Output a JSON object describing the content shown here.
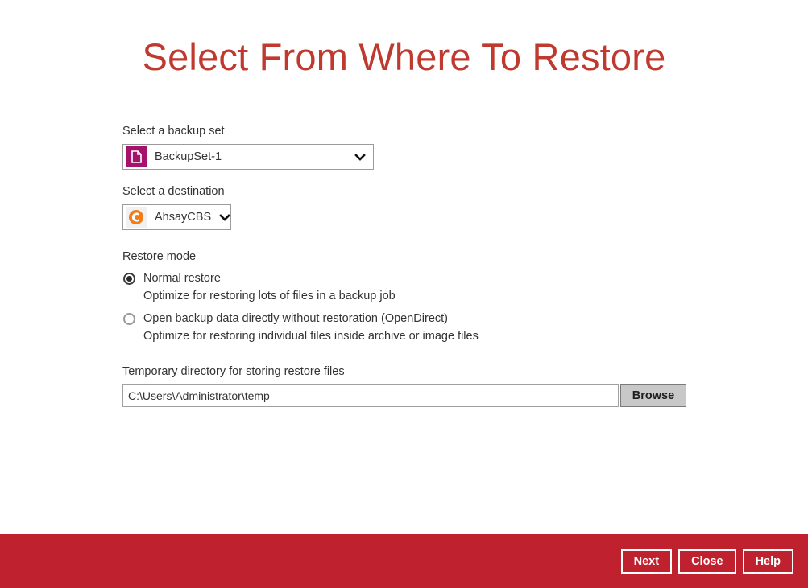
{
  "page": {
    "title": "Select From Where To Restore",
    "accent_color": "#c0392f",
    "footer_color": "#c0212f"
  },
  "backup_set": {
    "label": "Select a backup set",
    "selected": "BackupSet-1",
    "icon": "document-icon",
    "icon_color": "#a4126b",
    "caret": "chevron-down-icon"
  },
  "destination": {
    "label": "Select a destination",
    "selected": "AhsayCBS",
    "icon": "cbs-circle-icon",
    "icon_color": "#f07d1a",
    "caret": "chevron-down-icon"
  },
  "restore_mode": {
    "label": "Restore mode",
    "options": [
      {
        "label": "Normal restore",
        "description": "Optimize for restoring lots of files in a backup job",
        "selected": true
      },
      {
        "label": "Open backup data directly without restoration (OpenDirect)",
        "description": "Optimize for restoring individual files inside archive or image files",
        "selected": false
      }
    ]
  },
  "temp_directory": {
    "label": "Temporary directory for storing restore files",
    "value": "C:\\Users\\Administrator\\temp",
    "placeholder": "",
    "browse_label": "Browse"
  },
  "footer": {
    "next_label": "Next",
    "close_label": "Close",
    "help_label": "Help"
  }
}
